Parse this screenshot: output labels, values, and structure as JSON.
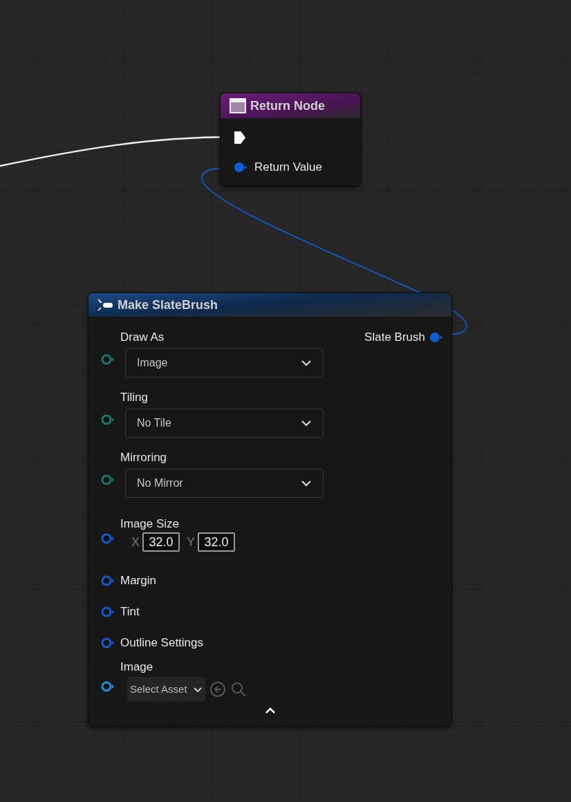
{
  "nodes": [
    {
      "kind": "result",
      "title": "Return Node",
      "pins": [
        {
          "kind": "exec",
          "connected": true
        },
        {
          "kind": "data",
          "label": "Return Value",
          "color": "#0b5fd6",
          "connected": true
        }
      ]
    },
    {
      "kind": "make",
      "title": "Make SlateBrush",
      "output": {
        "label": "Slate Brush",
        "color": "#0b5fd6",
        "connected": true
      },
      "inputs": [
        {
          "kind": "dropdown",
          "label": "Draw As",
          "value": "Image",
          "color": "#127a6e",
          "connected": false
        },
        {
          "kind": "dropdown",
          "label": "Tiling",
          "value": "No Tile",
          "color": "#127a6e",
          "connected": false
        },
        {
          "kind": "dropdown",
          "label": "Mirroring",
          "value": "No Mirror",
          "color": "#127a6e",
          "connected": false
        },
        {
          "kind": "vector2",
          "label": "Image Size",
          "color": "#0b5fd6",
          "connected": false,
          "fields": [
            {
              "axis": "X",
              "value": "32.0"
            },
            {
              "axis": "Y",
              "value": "32.0"
            }
          ]
        },
        {
          "kind": "plain",
          "label": "Margin",
          "color": "#0b5fd6",
          "connected": false
        },
        {
          "kind": "plain",
          "label": "Tint",
          "color": "#0b5fd6",
          "connected": false
        },
        {
          "kind": "plain",
          "label": "Outline Settings",
          "color": "#0b5fd6",
          "connected": false
        },
        {
          "kind": "asset",
          "label": "Image",
          "value": "Select Asset",
          "color": "#1a90e0",
          "connected": false
        }
      ]
    }
  ]
}
